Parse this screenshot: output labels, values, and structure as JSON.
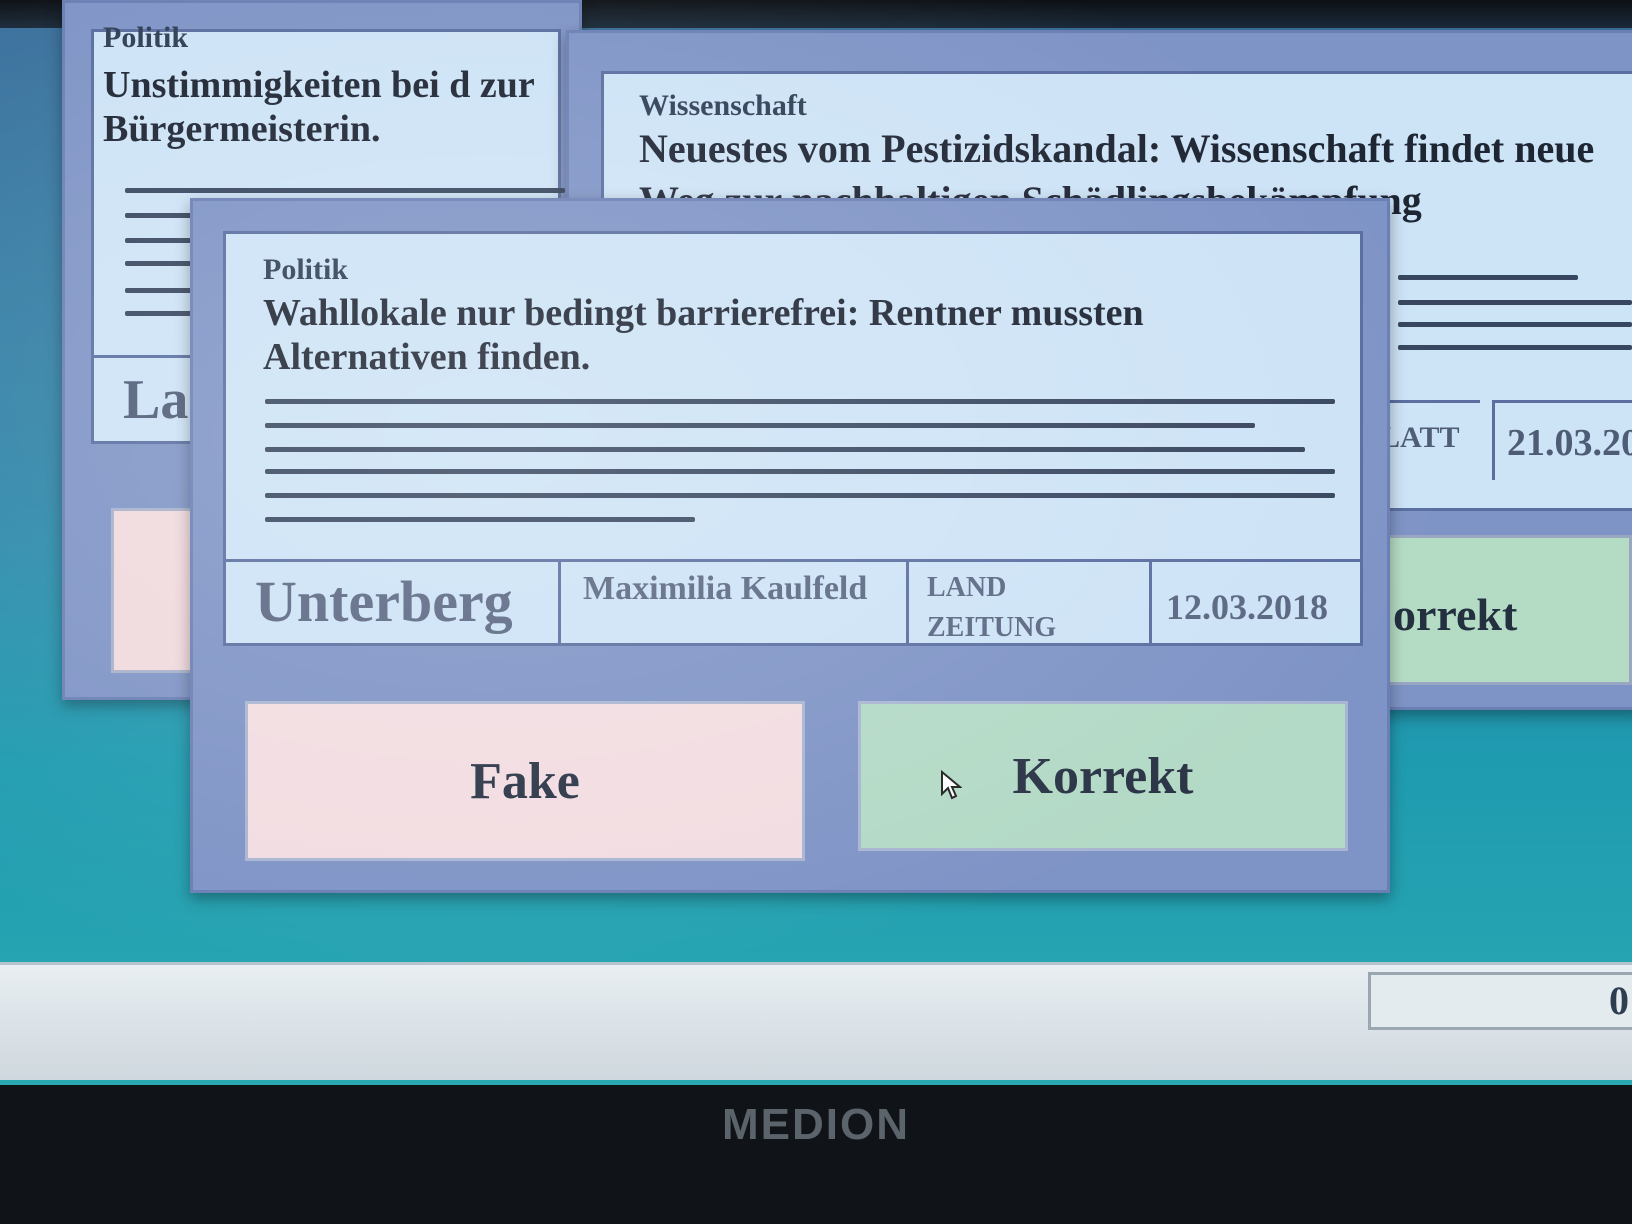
{
  "back_left_card": {
    "category": "Politik",
    "headline": "Unstimmigkeiten bei d zur Bürgermeisterin.",
    "place": "La"
  },
  "back_right_card": {
    "category": "Wissenschaft",
    "headline": "Neuestes vom Pestizidskandal: Wissenschaft findet neue Weg zur nachhaltigen Schädlingsbekämpfung",
    "source": "LATT",
    "date": "21.03.20",
    "korrekt_label": "orrekt"
  },
  "front_card": {
    "category": "Politik",
    "headline": "Wahllokale nur bedingt barrierefrei: Rentner mussten Alternativen finden.",
    "place": "Unterberg",
    "author": "Maximilia Kaulfeld",
    "source_line1": "LAND",
    "source_line2": "ZEITUNG",
    "date": "12.03.2018"
  },
  "actions": {
    "fake_label": "Fake",
    "korrekt_label": "Korrekt"
  },
  "status": {
    "score": "0"
  },
  "monitor": {
    "brand": "MEDION"
  }
}
